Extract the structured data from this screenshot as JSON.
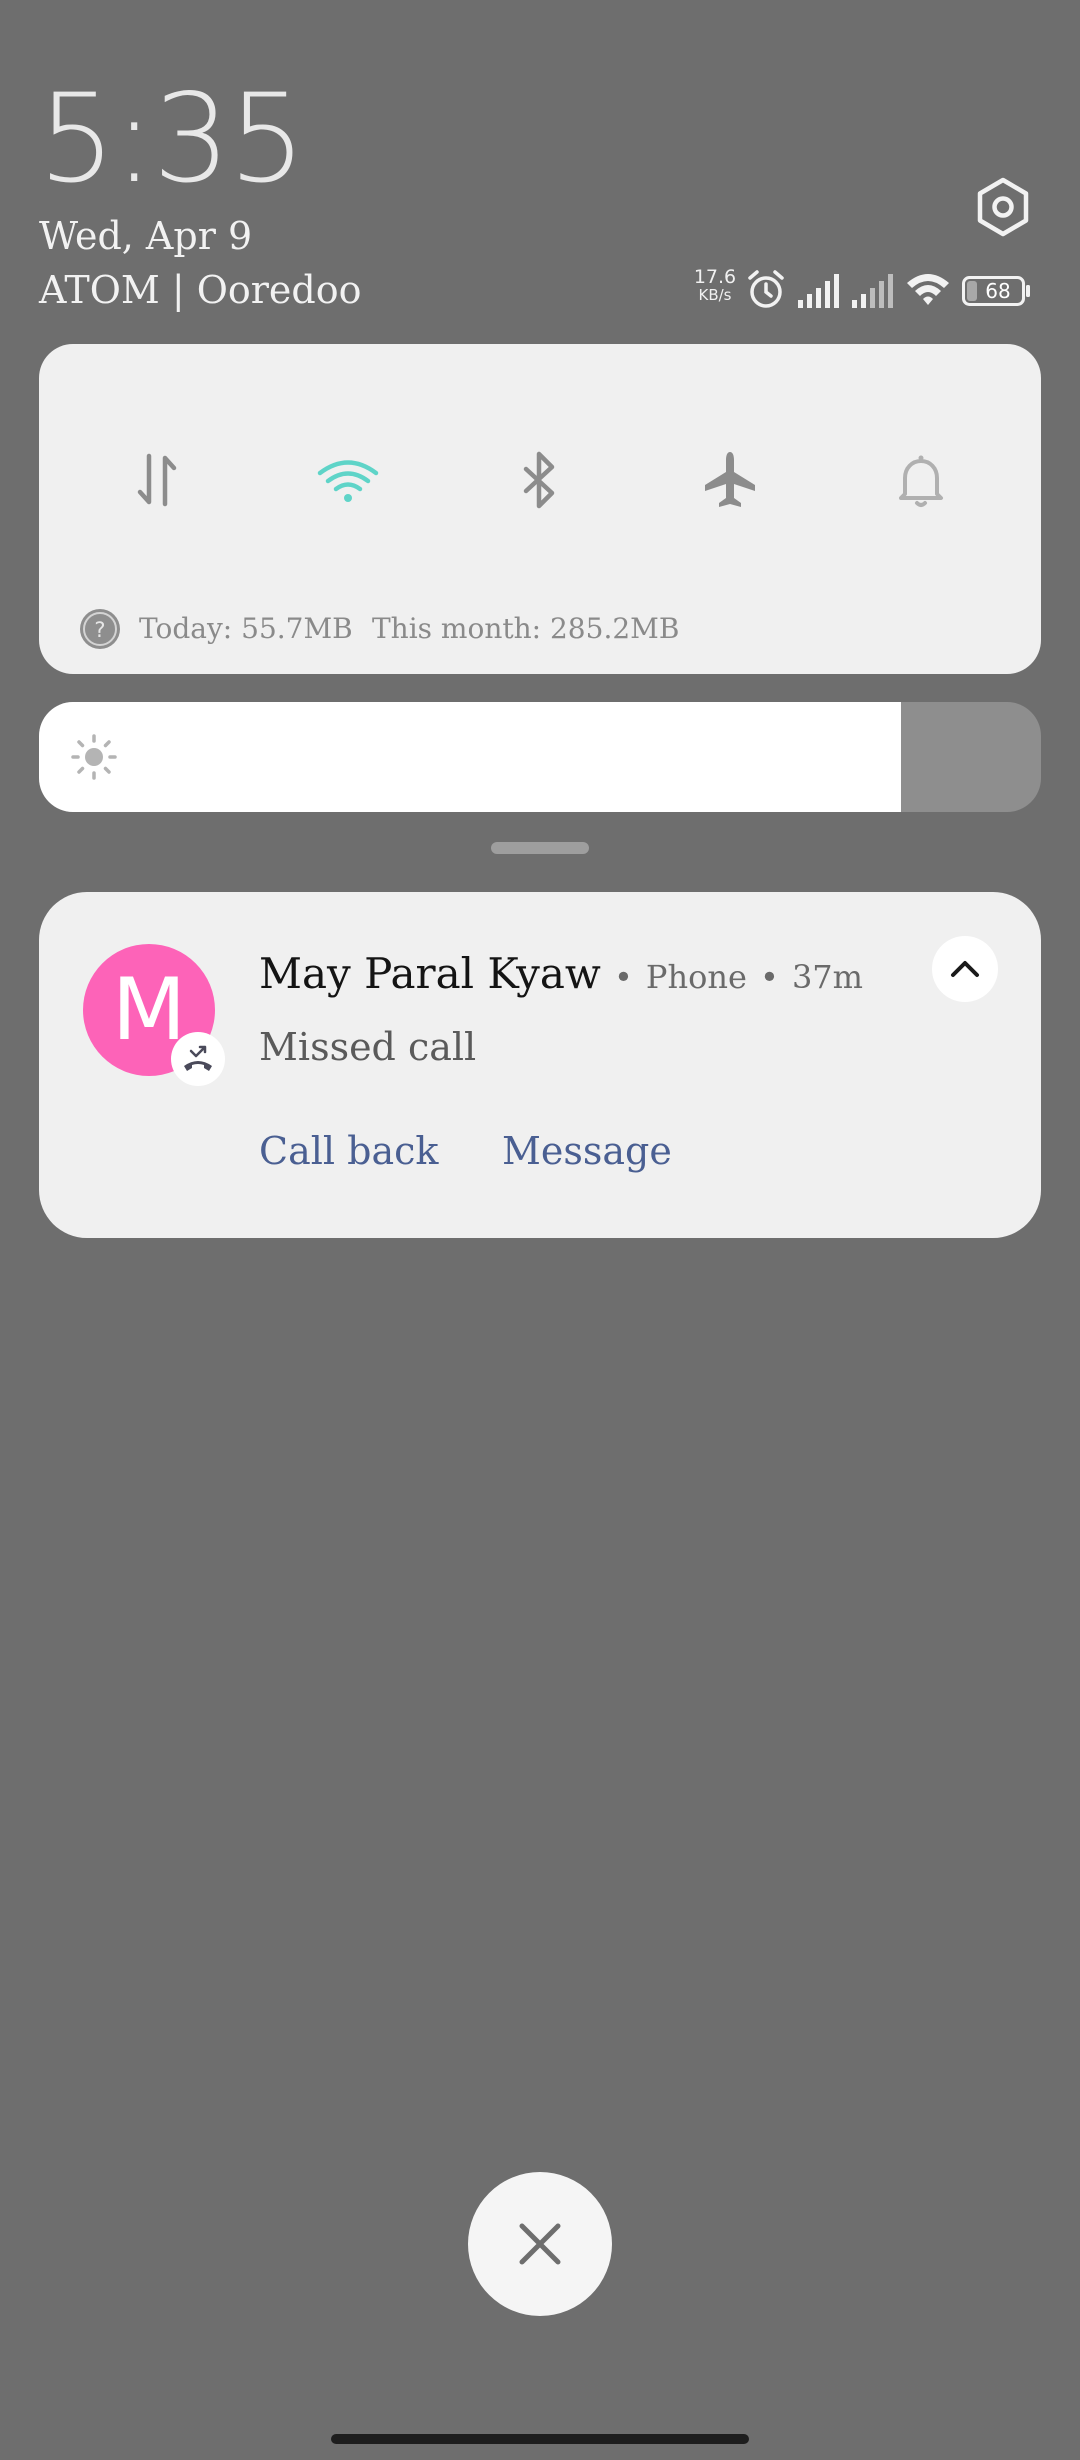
{
  "header": {
    "time": "5:35",
    "date": "Wed, Apr 9",
    "carrier": "ATOM | Ooredoo"
  },
  "status_bar": {
    "net_speed_value": "17.6",
    "net_speed_unit": "KB/s",
    "battery_level": "68",
    "icons": [
      "alarm-icon",
      "signal-icon",
      "signal-weak-icon",
      "wifi-icon",
      "battery-icon"
    ]
  },
  "quick_toggles": {
    "items": [
      {
        "name": "mobile-data",
        "icon": "data-transfer-icon",
        "active": false
      },
      {
        "name": "wifi",
        "icon": "wifi-icon",
        "active": true
      },
      {
        "name": "bluetooth",
        "icon": "bluetooth-icon",
        "active": false
      },
      {
        "name": "airplane-mode",
        "icon": "airplane-icon",
        "active": false
      },
      {
        "name": "sound",
        "icon": "bell-icon",
        "active": false
      }
    ],
    "data_usage": {
      "today": "Today: 55.7MB",
      "month": "This month: 285.2MB"
    }
  },
  "brightness": {
    "level": 0.86
  },
  "notification": {
    "avatar_letter": "M",
    "contact_name": "May Paral Kyaw",
    "app": "Phone",
    "separator": "•",
    "time_ago": "37m",
    "message": "Missed call",
    "actions": {
      "call_back": "Call back",
      "message": "Message"
    }
  },
  "colors": {
    "background": "#6e6e6e",
    "card": "#f0f0f0",
    "avatar": "#fd63b8",
    "wifi_active": "#5fd4c8",
    "action_link": "#4a5f92"
  }
}
